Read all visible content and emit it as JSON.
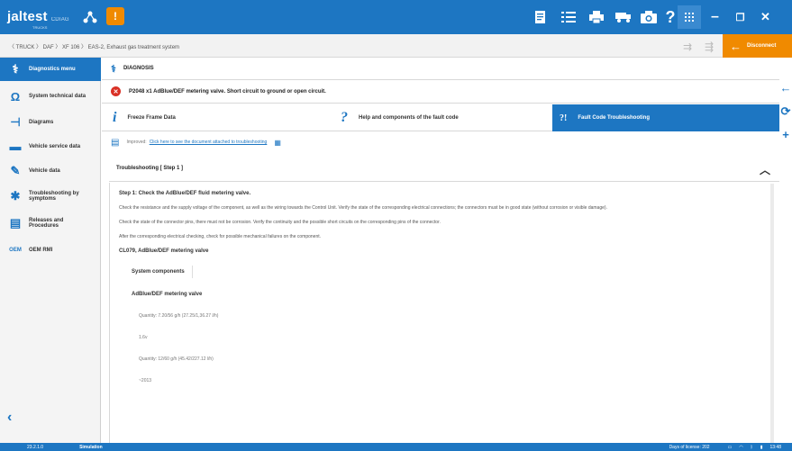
{
  "topbar": {
    "logo": "jaltest",
    "logo_sub": "CDIAG",
    "logo_tag": "TRUCKS",
    "warning": "!"
  },
  "toolbar_icons": [
    "report-icon",
    "list-icon",
    "printer-icon",
    "truck-icon",
    "camera-icon",
    "help-icon",
    "grid-icon"
  ],
  "window": {
    "min": "–",
    "restore": "❐",
    "close": "✕"
  },
  "breadcrumb": "〈 TRUCK  〉 DAF  〉 XF 106  〉 EAS-2, Exhaust gas treatment system",
  "disconnect_label": "Disconnect",
  "sidebar": {
    "items": [
      {
        "label": "Diagnostics menu",
        "icon": "⚕"
      },
      {
        "label": "System technical data",
        "icon": "Ω"
      },
      {
        "label": "Diagrams",
        "icon": "⊣"
      },
      {
        "label": "Vehicle service data",
        "icon": "▬"
      },
      {
        "label": "Vehicle data",
        "icon": "✎"
      },
      {
        "label": "Troubleshooting by symptoms",
        "icon": "✱"
      },
      {
        "label": "Releases and Procedures",
        "icon": "▤"
      },
      {
        "label": "OEM RMI",
        "icon": "OEM"
      }
    ],
    "back": "‹"
  },
  "diagnosis_title": "DIAGNOSIS",
  "fault": "P2048  x1  AdBlue/DEF metering valve. Short circuit to ground or open circuit.",
  "tabs": [
    {
      "label": "Freeze Frame Data",
      "icon": "i"
    },
    {
      "label": "Help and components of the fault code",
      "icon": "?"
    },
    {
      "label": "Fault Code Troubleshooting",
      "icon": "?!"
    }
  ],
  "improved": {
    "label": "Improved:",
    "link": "Click here to see the document attached to troubleshooting"
  },
  "troubleshooting_title": "Troubleshooting [ Step 1 ]",
  "step": {
    "title": "Step 1: Check the AdBlue/DEF fluid metering valve.",
    "para1": "Check the resistance and the supply voltage of the component, as well as the wiring towards the Control Unit. Verify the state of the corresponding electrical connections; the connectors must be in good state (without corrosion or visible damage).",
    "para2": "Check the state of the connector pins, there must not be corrosion. Verify the continuity and the possible short circuits on the corresponding pins of the connector.",
    "para3": "After the corresponding electrical checking, check for possible mechanical failures on the component.",
    "component_code": "CL079, AdBlue/DEF metering valve",
    "system_components": "System components",
    "component_name": "AdBlue/DEF metering valve",
    "value1": "Quantity: 7.20/56 g/h (27.25/1,36.27 l/h)",
    "value2": "1.6v",
    "value3": "Quantity: 12/60 g/h (45.42/227.12 l/h)",
    "value4": "~2013"
  },
  "status": {
    "version": "23.2.1.0",
    "mode": "Simulation",
    "license": "Days of license: 202",
    "time": "13:48"
  },
  "colors": {
    "primary": "#1d76c2",
    "accent": "#f08a00",
    "error": "#d93025"
  }
}
